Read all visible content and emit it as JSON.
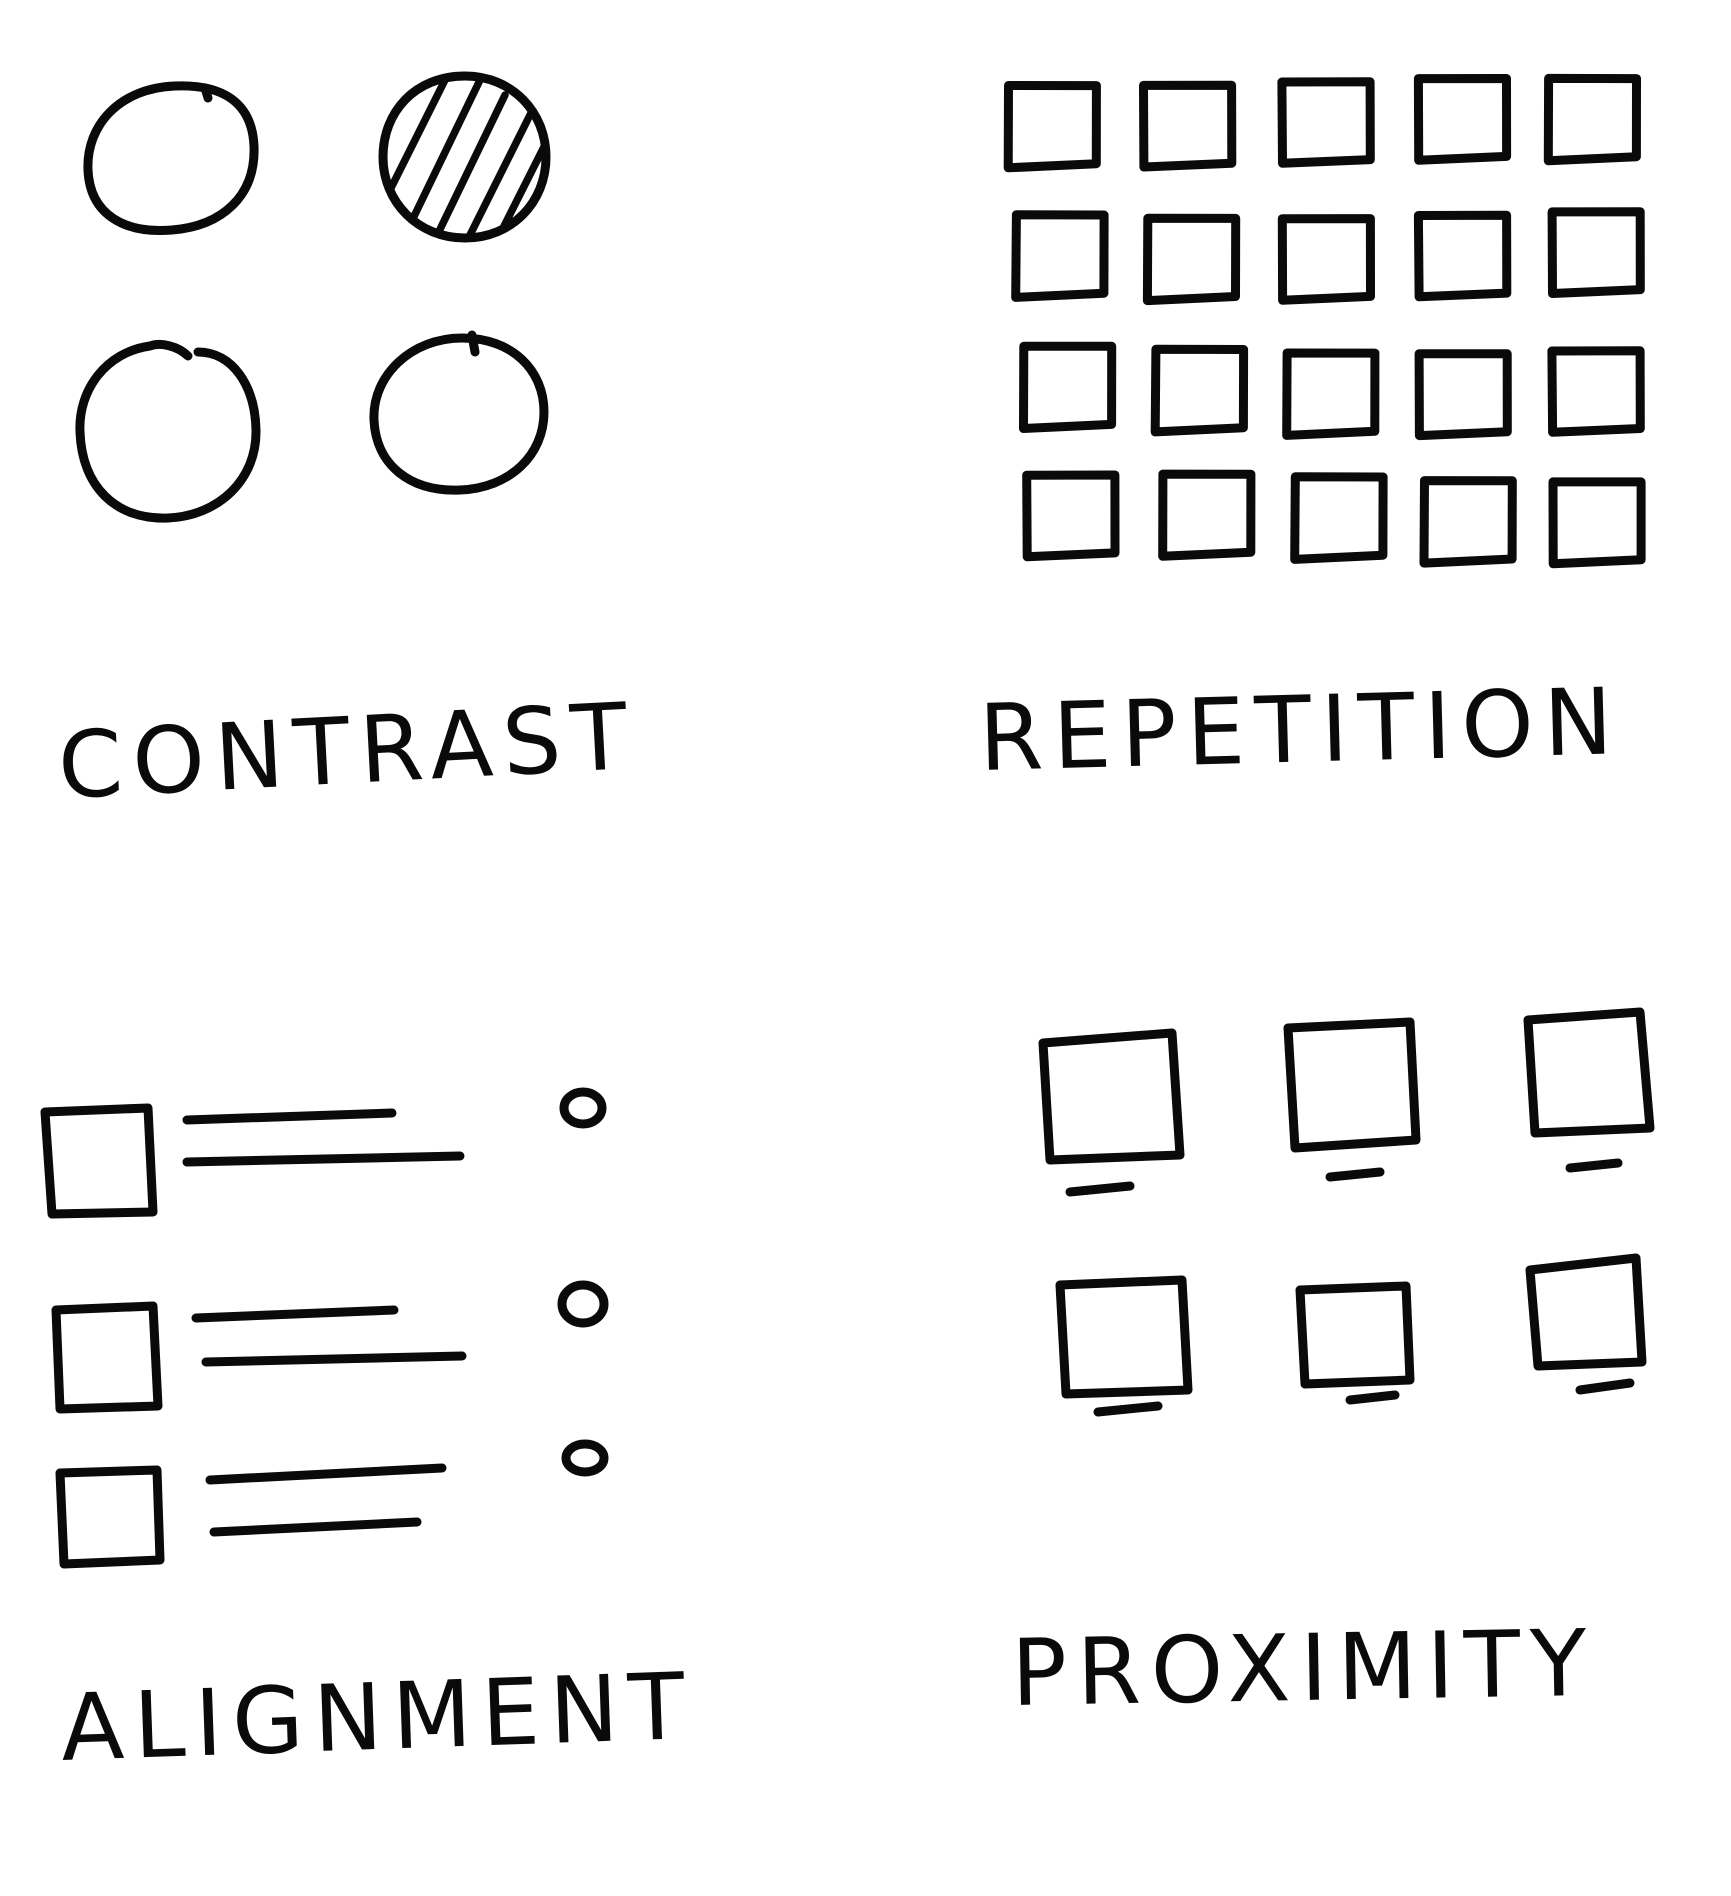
{
  "ink_color": "#0a0a0a",
  "background_color": "#ffffff",
  "panels": [
    {
      "id": "contrast",
      "label": "CONTRAST",
      "icon": "four-circles-one-hatched"
    },
    {
      "id": "repetition",
      "label": "REPETITION",
      "icon": "grid-of-squares"
    },
    {
      "id": "alignment",
      "label": "ALIGNMENT",
      "icon": "aligned-list-rows"
    },
    {
      "id": "proximity",
      "label": "PROXIMITY",
      "icon": "grouped-squares-with-captions"
    }
  ]
}
